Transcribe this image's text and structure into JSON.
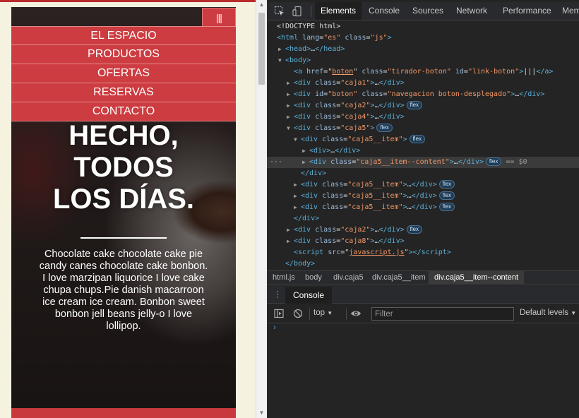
{
  "site": {
    "menu_toggle": "|||",
    "nav": [
      "EL ESPACIO",
      "PRODUCTOS",
      "OFERTAS",
      "RESERVAS",
      "CONTACTO"
    ],
    "hero_title_lines": [
      "HECHO,",
      "TODOS",
      "LOS DÍAS."
    ],
    "hero_text": "Chocolate cake chocolate cake pie candy canes chocolate cake bonbon. I love marzipan liquorice I love cake chupa chups.Pie danish macarroon ice cream ice cream. Bonbon sweet bonbon jell beans jelly-o I love lollipop.",
    "colors": {
      "nav_red": "#cc3c40",
      "page_bg": "#f5f3e0"
    }
  },
  "devtools": {
    "tabs": [
      "Elements",
      "Console",
      "Sources",
      "Network",
      "Performance",
      "Mem"
    ],
    "active_tab": "Elements",
    "dom": {
      "doctype": "<!DOCTYPE html>",
      "html_attrs": {
        "lang": "\"es\"",
        "class": "\"js\""
      },
      "a_text": "|||",
      "a_href": "boton",
      "a_class": "\"tirador-boton\"",
      "a_id": "\"link-boton\"",
      "div_id_boton": "\"boton\"",
      "div_class_nav": "\"navegacion boton-desplegado\"",
      "caja1": "\"caja1\"",
      "caja2": "\"caja2\"",
      "caja4": "\"caja4\"",
      "caja5": "\"caja5\"",
      "caja5_item": "\"caja5__item\"",
      "caja5_item_content": "\"caja5__item--content\"",
      "caja8": "\"caja8\"",
      "script_src": "javascript.js",
      "badge": "flex",
      "selected_suffix": "== $0"
    },
    "breadcrumbs": [
      "html.js",
      "body",
      "div.caja5",
      "div.caja5__item",
      "div.caja5__item--content"
    ],
    "console": {
      "tab": "Console",
      "context": "top",
      "filter_placeholder": "Filter",
      "levels": "Default levels",
      "prompt": "›"
    }
  }
}
